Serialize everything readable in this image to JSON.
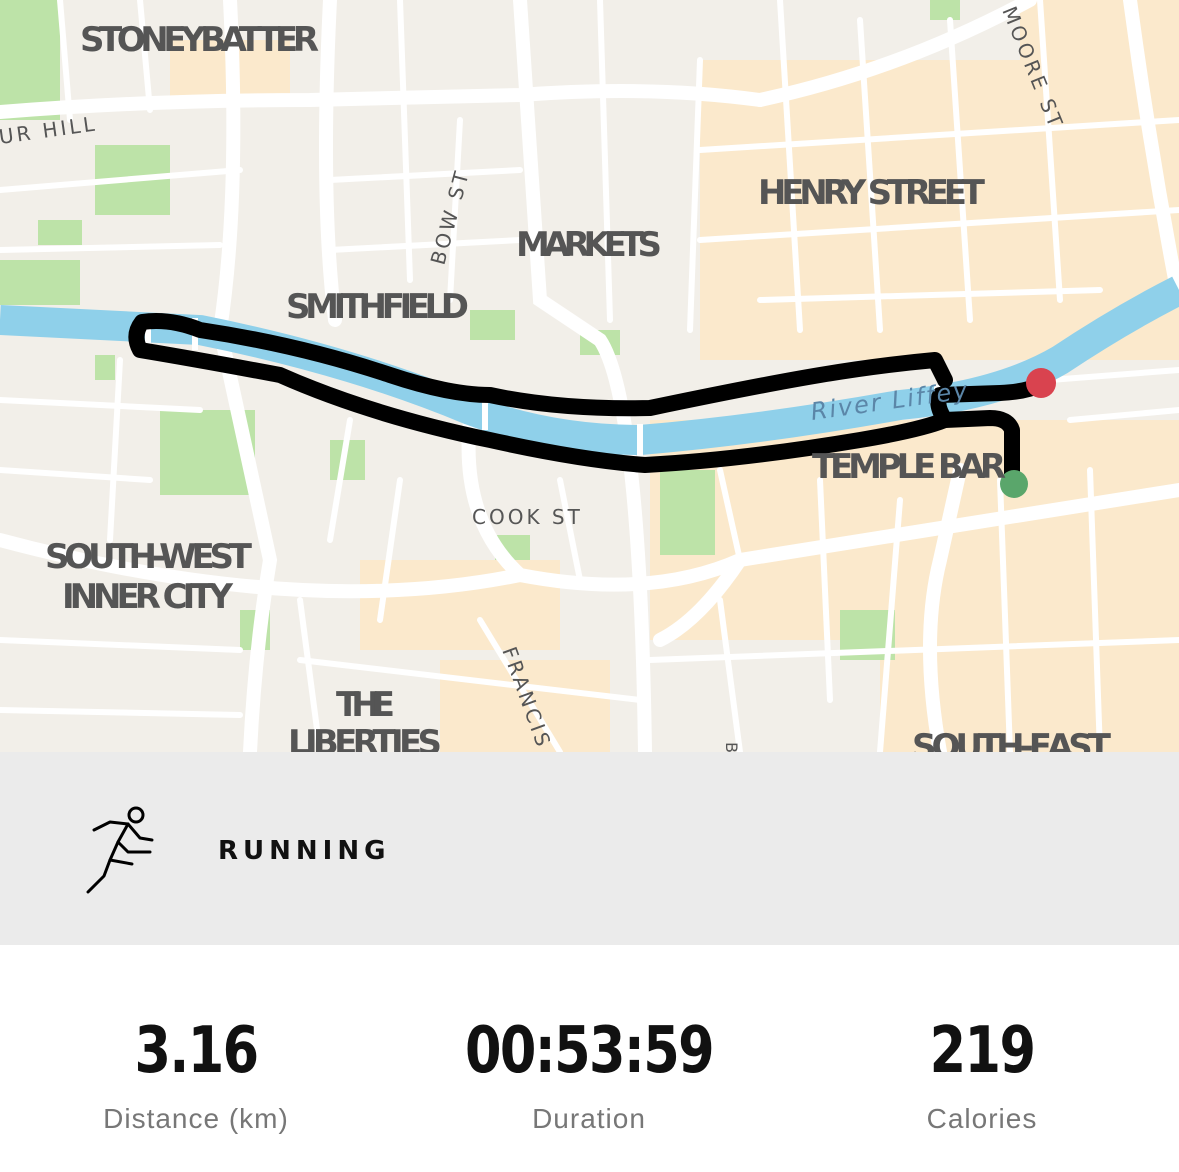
{
  "map": {
    "districts": {
      "stoneybatter": "STONEYBATTER",
      "smithfield": "SMITHFIELD",
      "markets": "MARKETS",
      "henry_street": "HENRY STREET",
      "temple_bar": "TEMPLE BAR",
      "south_west_line1": "SOUTH-WEST",
      "south_west_line2": "INNER CITY",
      "liberties_line1": "THE",
      "liberties_line2": "LIBERTIES",
      "south_east": "SOUTH-EAST"
    },
    "streets": {
      "arbour_hill": "UR HILL",
      "bow_st": "BOW ST",
      "moore_st": "MOORE ST",
      "cook_st": "COOK ST",
      "francis": "FRANCIS",
      "b_street": "B"
    },
    "river": "River Liffey",
    "colors": {
      "land": "#f2efe9",
      "river": "#8fd0ea",
      "park": "#bde3a8",
      "commercial": "#fbe9cc",
      "route": "#000000",
      "start_marker": "#5aa66b",
      "end_marker": "#d9434f"
    }
  },
  "activity": {
    "icon": "running-person-icon",
    "type": "RUNNING"
  },
  "stats": [
    {
      "value": "3.16",
      "label": "Distance (km)"
    },
    {
      "value": "00:53:59",
      "label": "Duration"
    },
    {
      "value": "219",
      "label": "Calories"
    }
  ]
}
